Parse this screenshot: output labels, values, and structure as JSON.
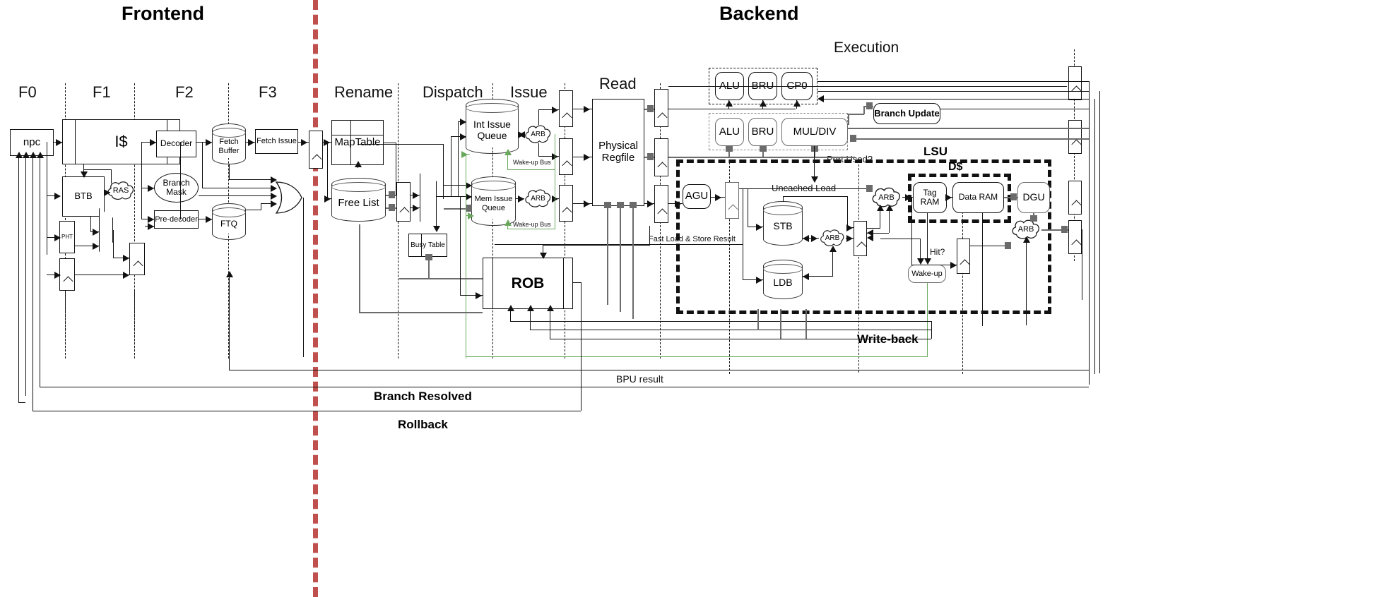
{
  "sections": {
    "frontend": "Frontend",
    "backend": "Backend",
    "execution": "Execution"
  },
  "stages": [
    {
      "id": "f0",
      "label": "F0"
    },
    {
      "id": "f1",
      "label": "F1"
    },
    {
      "id": "f2",
      "label": "F2"
    },
    {
      "id": "f3",
      "label": "F3"
    },
    {
      "id": "rename",
      "label": "Rename"
    },
    {
      "id": "dispatch",
      "label": "Dispatch"
    },
    {
      "id": "issue",
      "label": "Issue"
    },
    {
      "id": "read",
      "label": "Read"
    }
  ],
  "frontend_blocks": {
    "npc": "npc",
    "icache": "I$",
    "btb": "BTB",
    "ras": "RAS",
    "pht": "PHT",
    "decoder": "Decoder",
    "branch_mask": "Branch\nMask",
    "pre_decoder": "Pre-decoder",
    "fetch_buffer": "Fetch\nBuffer",
    "ftq": "FTQ",
    "fetch_issue": "Fetch Issue"
  },
  "rename_blocks": {
    "maptable": "MapTable",
    "freelist": "Free List",
    "busy_table": "Busy Table"
  },
  "issue_blocks": {
    "int_issue_queue": "Int Issue\nQueue",
    "mem_issue_queue": "Mem Issue\nQueue",
    "arb": "ARB",
    "wakeup_bus": "Wake-up Bus"
  },
  "read_blocks": {
    "physical_regfile": "Physical\nRegfile"
  },
  "exec_blocks": {
    "alu": "ALU",
    "bru": "BRU",
    "cp0": "CP0",
    "muldiv": "MUL/DIV",
    "branch_update": "Branch Update"
  },
  "rob": "ROB",
  "lsu": {
    "title": "LSU",
    "dcache_title": "D$",
    "agu": "AGU",
    "stb": "STB",
    "ldb": "LDB",
    "arb": "ARB",
    "tag_ram": "Tag RAM",
    "data_ram": "Data RAM",
    "dgu": "DGU",
    "wakeup": "Wake-up"
  },
  "annotations": {
    "port_used": "Port Used?",
    "uncached_load": "Uncached Load",
    "fast_load_store_result": "Fast Load & Store Result",
    "hit": "Hit?",
    "write_back": "Write-back",
    "bpu_result": "BPU result",
    "branch_resolved": "Branch Resolved",
    "rollback": "Rollback"
  },
  "colors": {
    "divider_red": "#c0504d",
    "wakeup_green": "#69a85c",
    "wire_gray": "#6b6b6b",
    "ink": "#111111"
  }
}
